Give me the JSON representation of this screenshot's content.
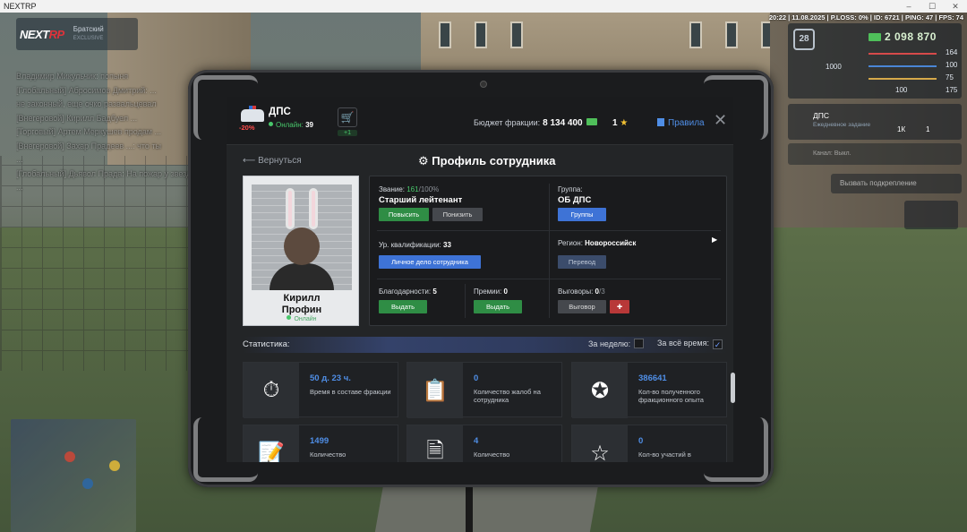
{
  "window": {
    "title": "NEXTRP"
  },
  "hud": {
    "brand_a": "NEXT",
    "brand_b": "RP",
    "server_name": "Братский",
    "server_sub": "EXCLUSIVE",
    "info_line": "20:22 | 11.08.2025 | P.LOSS: 0% | ID: 6721 | PING: 47 | FPS: 74",
    "level": "28",
    "money": "2 098 870",
    "stat_left": "1000",
    "stat_vals": [
      "164",
      "100",
      "75",
      "175"
    ],
    "stat_small": "100",
    "job_title": "ДПС",
    "job_sub": "Ежедневное задание",
    "job_count_a": "1К",
    "job_count_b": "1",
    "channel": "Канал: Выкл.",
    "backup": "Вызвать подкрепление"
  },
  "chat": [
    "Владимир Микульчик: попыня",
    "[Глобальный] Абросимов Дмитрий: ...",
    "не законный, еще очко развальцевал",
    "[Внегеровой] Кирилл Бадбуел ...",
    "[Торговый] Артем Меркушев продам ...",
    "[Внегеровой] Захар Прадеев ...: что ты",
    "...",
    "[Глобальный] Дьявол Прада: На пожар у звезд",
    "..."
  ],
  "faction": {
    "name": "ДПС",
    "discount": "-20%",
    "online_label": "Онлайн:",
    "online_count": "39",
    "shop_badge": "+1",
    "budget_label": "Бюджет фракции:",
    "budget_value": "8 134 400",
    "stars": "1",
    "rules": "Правила"
  },
  "nav": {
    "back": "Вернуться",
    "title": "Профиль сотрудника"
  },
  "employee": {
    "first_name": "Кирилл",
    "last_name": "Профин",
    "status": "Онлайн",
    "rank_label": "Звание:",
    "rank_value": "161",
    "rank_max": "/100%",
    "rank_name": "Старший лейтенант",
    "promote": "Повысить",
    "demote": "Понизить",
    "group_label": "Группа:",
    "group_value": "ОБ ДПС",
    "groups_btn": "Группы",
    "qual_label": "Ур. квалификации:",
    "qual_value": "33",
    "file_btn": "Личное дело сотрудника",
    "region_label": "Регион:",
    "region_value": "Новороссийск",
    "transfer_btn": "Перевод",
    "thanks_label": "Благодарности:",
    "thanks_value": "5",
    "thanks_btn": "Выдать",
    "bonus_label": "Премии:",
    "bonus_value": "0",
    "bonus_btn": "Выдать",
    "warn_label": "Выговоры:",
    "warn_value": "0",
    "warn_max": "/3",
    "warn_btn": "Выговор"
  },
  "stats": {
    "title": "Статистика:",
    "week": "За неделю:",
    "all": "За всё время:",
    "tiles": [
      {
        "value": "50 д. 23 ч.",
        "label": "Время в составе фракции",
        "icon": "stopwatch-icon"
      },
      {
        "value": "0",
        "label": "Количество жалоб на сотрудника",
        "icon": "complaint-icon"
      },
      {
        "value": "386641",
        "label": "Кол-во полученного фракционного опыта",
        "icon": "exp-badge-icon"
      },
      {
        "value": "1499",
        "label": "Количество",
        "icon": "clipboard-icon"
      },
      {
        "value": "4",
        "label": "Количество",
        "icon": "document-icon"
      },
      {
        "value": "0",
        "label": "Кол-во участий в",
        "icon": "star-icon"
      }
    ]
  }
}
